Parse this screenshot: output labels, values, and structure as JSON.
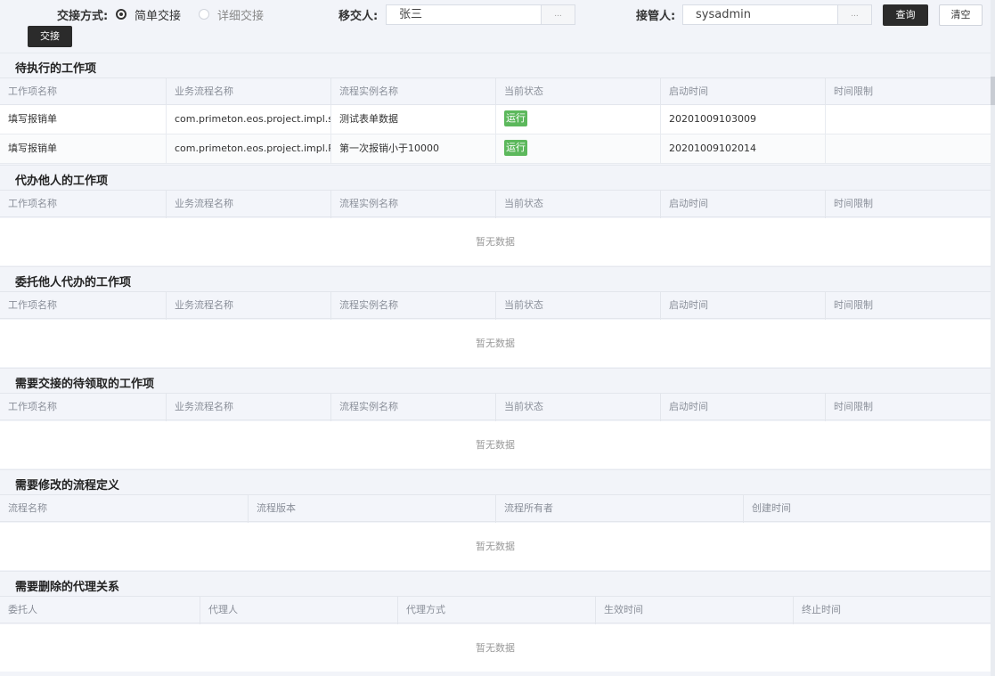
{
  "toolbar": {
    "handover_mode_label": "交接方式:",
    "mode_simple": "简单交接",
    "mode_detail": "详细交接",
    "from_label": "移交人:",
    "from_value": "张三",
    "to_label": "接管人:",
    "to_value": "sysadmin",
    "picker_label": "...",
    "query_label": "查询",
    "clear_label": "清空",
    "handover_label": "交接"
  },
  "sections": {
    "pending": {
      "title": "待执行的工作项",
      "columns": [
        "工作项名称",
        "业务流程名称",
        "流程实例名称",
        "当前状态",
        "启动时间",
        "时间限制"
      ],
      "rows": [
        [
          "填写报销单",
          "com.primeton.eos.project.impl.s...",
          "测试表单数据",
          "运行",
          "20201009103009",
          ""
        ],
        [
          "填写报销单",
          "com.primeton.eos.project.impl.R...",
          "第一次报销小于10000",
          "运行",
          "20201009102014",
          ""
        ]
      ]
    },
    "agent_for_others": {
      "title": "代办他人的工作项",
      "columns": [
        "工作项名称",
        "业务流程名称",
        "流程实例名称",
        "当前状态",
        "启动时间",
        "时间限制"
      ],
      "empty": "暂无数据"
    },
    "delegated": {
      "title": "委托他人代办的工作项",
      "columns": [
        "工作项名称",
        "业务流程名称",
        "流程实例名称",
        "当前状态",
        "启动时间",
        "时间限制"
      ],
      "empty": "暂无数据"
    },
    "unclaimed": {
      "title": "需要交接的待领取的工作项",
      "columns": [
        "工作项名称",
        "业务流程名称",
        "流程实例名称",
        "当前状态",
        "启动时间",
        "时间限制"
      ],
      "empty": "暂无数据"
    },
    "process_defs": {
      "title": "需要修改的流程定义",
      "columns": [
        "流程名称",
        "流程版本",
        "流程所有者",
        "创建时间"
      ],
      "empty": "暂无数据"
    },
    "agency": {
      "title": "需要删除的代理关系",
      "columns": [
        "委托人",
        "代理人",
        "代理方式",
        "生效时间",
        "终止时间"
      ],
      "empty": "暂无数据"
    }
  },
  "colors": {
    "status_running": "#5cb85c",
    "dark_button": "#2b2b2b"
  }
}
